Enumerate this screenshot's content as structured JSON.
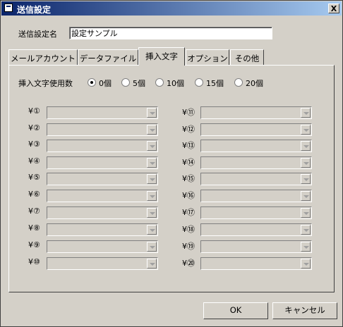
{
  "window": {
    "title": "送信設定",
    "close_label": "X"
  },
  "name_field": {
    "label": "送信設定名",
    "value": "設定サンプル"
  },
  "tabs": [
    {
      "label": "メールアカウント",
      "active": false
    },
    {
      "label": "データファイル",
      "active": false
    },
    {
      "label": "挿入文字",
      "active": true
    },
    {
      "label": "オプション",
      "active": false
    },
    {
      "label": "その他",
      "active": false
    }
  ],
  "insert_count": {
    "label": "挿入文字使用数",
    "options": [
      "0個",
      "5個",
      "10個",
      "15個",
      "20個"
    ],
    "selected": "0個"
  },
  "slots_left": [
    "¥①",
    "¥②",
    "¥③",
    "¥④",
    "¥⑤",
    "¥⑥",
    "¥⑦",
    "¥⑧",
    "¥⑨",
    "¥⑩"
  ],
  "slots_right": [
    "¥⑪",
    "¥⑫",
    "¥⑬",
    "¥⑭",
    "¥⑮",
    "¥⑯",
    "¥⑰",
    "¥⑱",
    "¥⑲",
    "¥⑳"
  ],
  "buttons": {
    "ok": "OK",
    "cancel": "キャンセル"
  }
}
